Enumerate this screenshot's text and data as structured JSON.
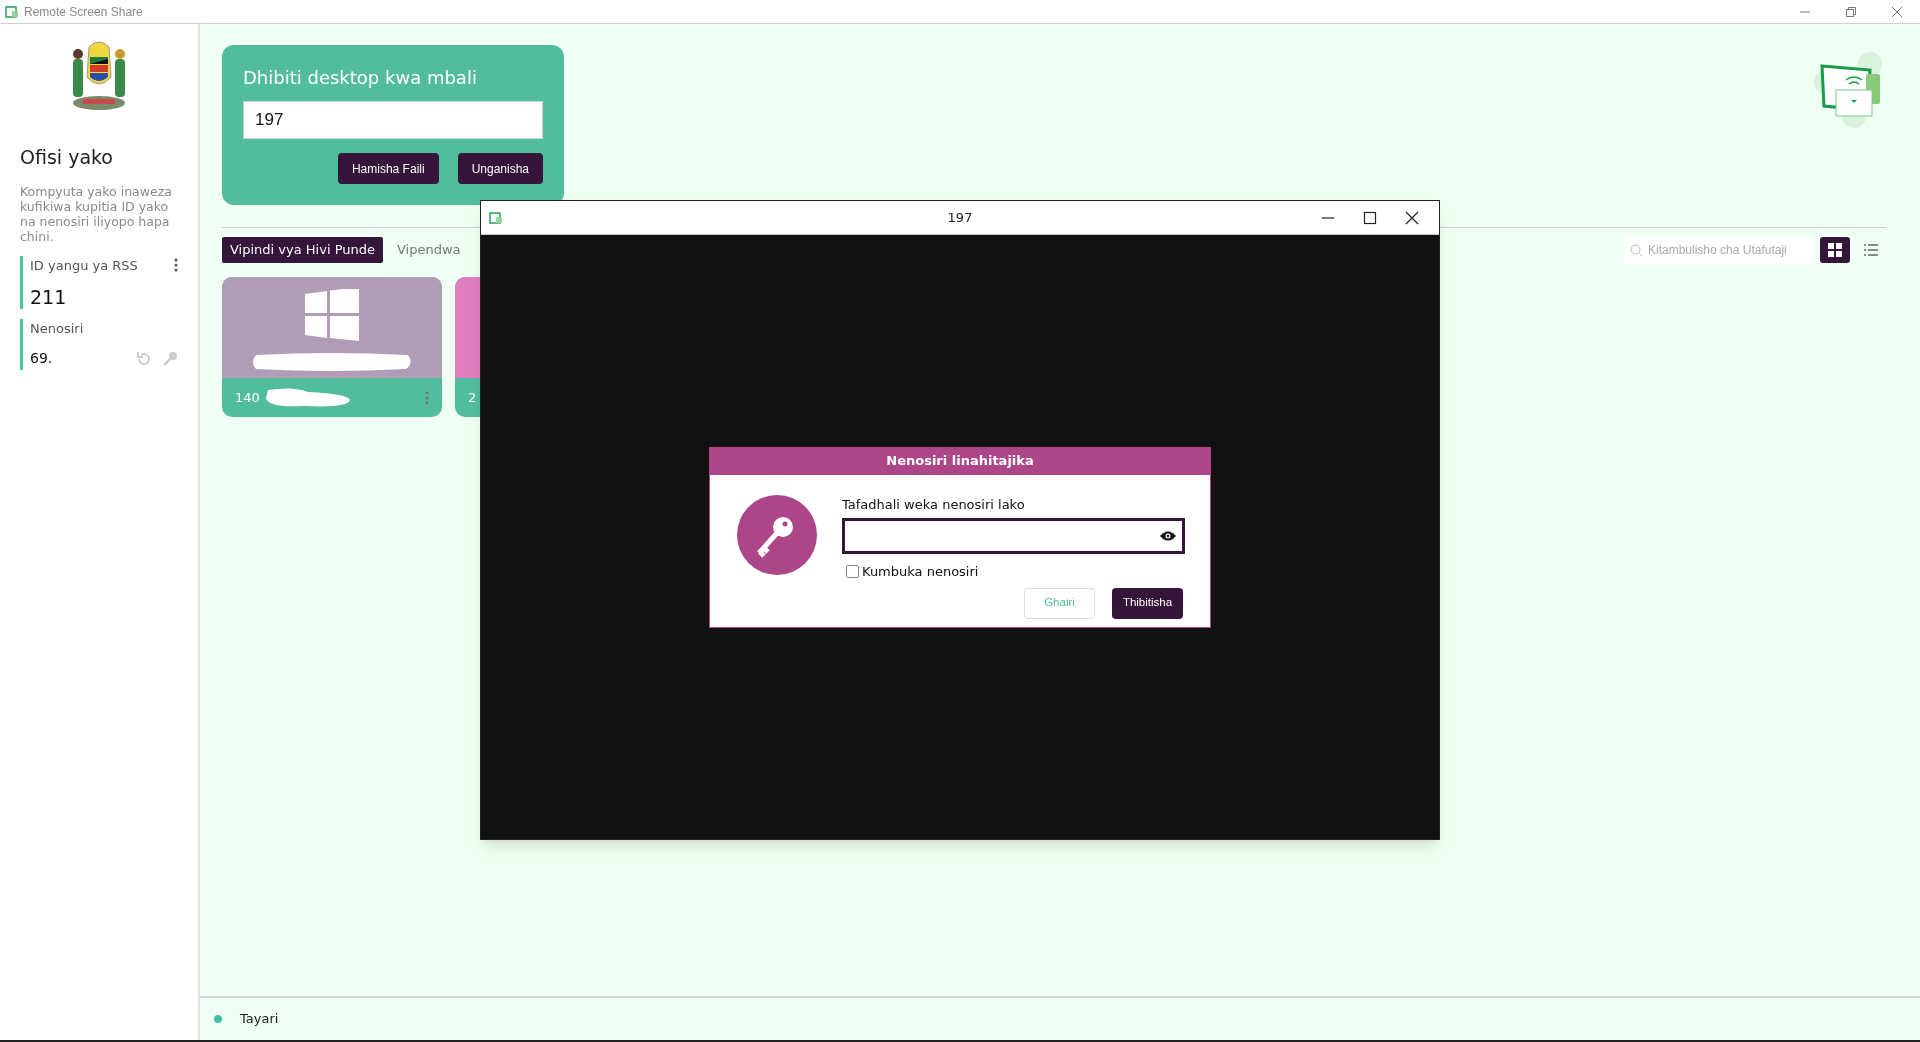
{
  "app_window": {
    "title": "Remote Screen Share"
  },
  "sidebar": {
    "heading": "Ofisi yako",
    "description": "Kompyuta yako inaweza kufikiwa kupitia ID yako na nenosiri iliyopo hapa chini.",
    "id_section": {
      "label": "ID yangu ya RSS",
      "value": "211"
    },
    "password_section": {
      "label": "Nenosiri",
      "value": "69."
    }
  },
  "connect_card": {
    "title": "Dhibiti desktop kwa mbali",
    "id_value": "197",
    "buttons": [
      "Hamisha Faili",
      "Unganisha"
    ]
  },
  "tabs": [
    {
      "label": "Vipindi vya Hivi Punde",
      "selected": true
    },
    {
      "label": "Vipendwa",
      "selected": false
    }
  ],
  "search": {
    "placeholder": "Kitambulisho cha Utafutaji"
  },
  "view_modes": [
    {
      "kind": "grid",
      "selected": true
    },
    {
      "kind": "list",
      "selected": false
    }
  ],
  "sessions": [
    {
      "id": "140",
      "color": "#b09cb4",
      "kind": "visible"
    },
    {
      "id": "2",
      "color": "#e07fc0",
      "kind": "covered"
    }
  ],
  "status": {
    "text": "Tayari"
  },
  "remote_window": {
    "title": "197",
    "dialog": {
      "title": "Nenosiri linahitajika",
      "prompt": "Tafadhali weka nenosiri lako",
      "checkbox": {
        "label": "Kumbuka nenosiri",
        "checked": false
      },
      "buttons": [
        {
          "label": "Ghairi",
          "kind": "secondary"
        },
        {
          "label": "Thibitisha",
          "kind": "primary"
        }
      ]
    }
  }
}
